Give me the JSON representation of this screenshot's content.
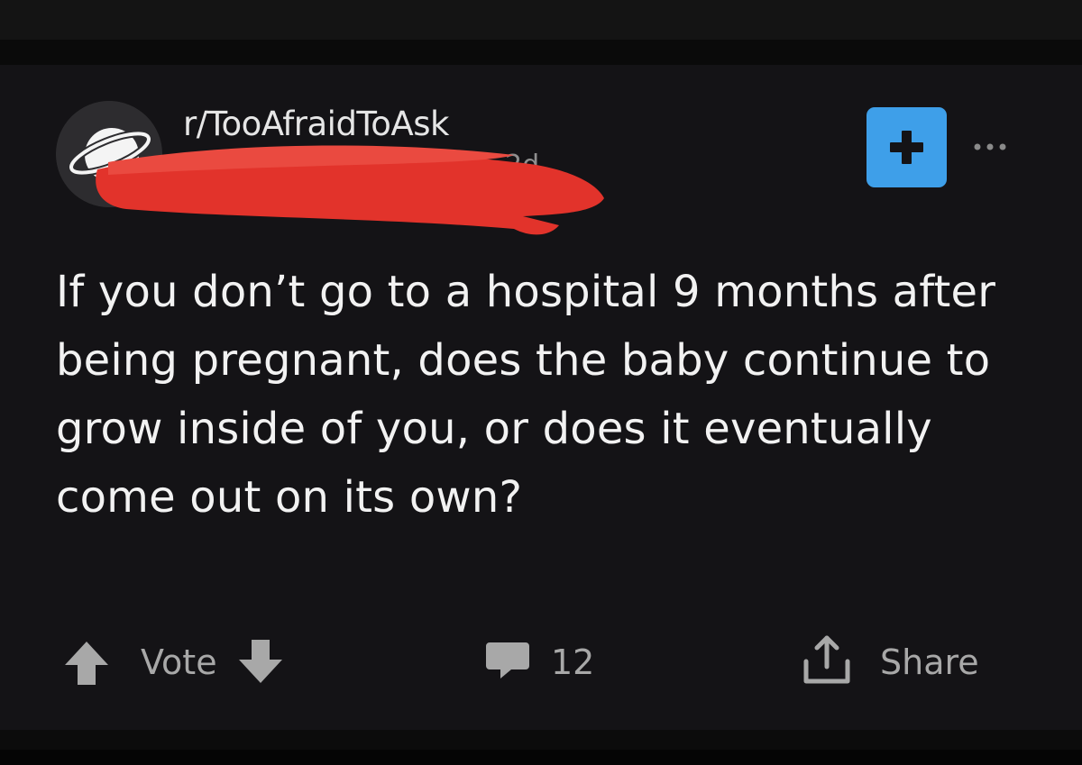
{
  "post": {
    "subreddit": "r/TooAfraidToAsk",
    "age": "2d",
    "title": "If you don’t go to a hospital 9 months after being pregnant, does the baby continue to grow inside of you, or does it eventually come out on its own?"
  },
  "actions": {
    "vote_label": "Vote",
    "comment_count": "12",
    "share_label": "Share"
  },
  "icons": {
    "avatar": "planet-icon",
    "join": "plus-icon",
    "more": "ellipsis-icon",
    "upvote": "arrow-up-icon",
    "downvote": "arrow-down-icon",
    "comments": "comment-bubble-icon",
    "share": "share-icon"
  },
  "colors": {
    "background": "#141316",
    "accent": "#3e9fe9",
    "text": "#f2f2f2",
    "muted": "#a8a8a8",
    "redaction": "#e2332b"
  }
}
